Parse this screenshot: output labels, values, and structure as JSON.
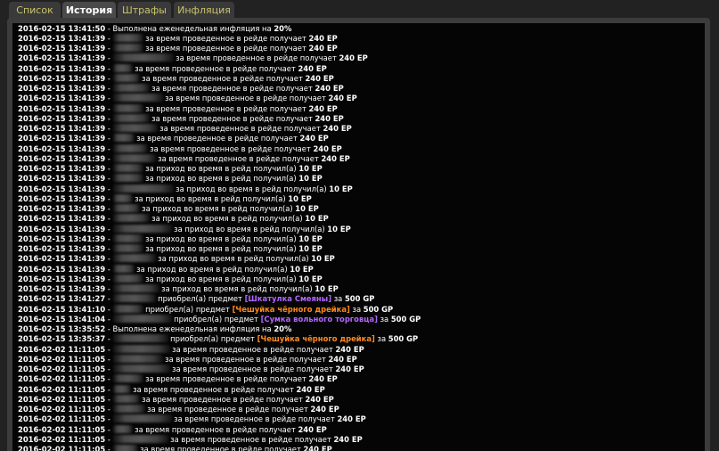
{
  "tabs": [
    {
      "label": "Список",
      "active": false
    },
    {
      "label": "История",
      "active": true
    },
    {
      "label": "Штрафы",
      "active": false
    },
    {
      "label": "Инфляция",
      "active": false
    }
  ],
  "log": [
    {
      "ts": "2016-02-15 13:41:50",
      "text": "- Выполнена еженедельная инфляция на",
      "amount": "20%",
      "blur": 0,
      "kind": "inflation"
    },
    {
      "ts": "2016-02-15 13:41:39",
      "text": "за время проведенное в рейде получает",
      "amount": "240 EP",
      "blur": 34
    },
    {
      "ts": "2016-02-15 13:41:39",
      "text": "за время проведенное в рейде получает",
      "amount": "240 EP",
      "blur": 34
    },
    {
      "ts": "2016-02-15 13:41:39",
      "text": "за время проведенное в рейде получает",
      "amount": "240 EP",
      "blur": 68
    },
    {
      "ts": "2016-02-15 13:41:39",
      "text": "за время проведенное в рейде получает",
      "amount": "240 EP",
      "blur": 22
    },
    {
      "ts": "2016-02-15 13:41:39",
      "text": "за время проведенное в рейде получает",
      "amount": "240 EP",
      "blur": 30
    },
    {
      "ts": "2016-02-15 13:41:39",
      "text": "за время проведенное в рейде получает",
      "amount": "240 EP",
      "blur": 41
    },
    {
      "ts": "2016-02-15 13:41:39",
      "text": "за время проведенное в рейде получает",
      "amount": "240 EP",
      "blur": 56
    },
    {
      "ts": "2016-02-15 13:41:39",
      "text": "за время проведенное в рейде получает",
      "amount": "240 EP",
      "blur": 34
    },
    {
      "ts": "2016-02-15 13:41:39",
      "text": "за время проведенное в рейде получает",
      "amount": "240 EP",
      "blur": 41
    },
    {
      "ts": "2016-02-15 13:41:39",
      "text": "за время проведенное в рейде получает",
      "amount": "240 EP",
      "blur": 50
    },
    {
      "ts": "2016-02-15 13:41:39",
      "text": "за время проведенное в рейде получает",
      "amount": "240 EP",
      "blur": 24
    },
    {
      "ts": "2016-02-15 13:41:39",
      "text": "за время проведенное в рейде получает",
      "amount": "240 EP",
      "blur": 39
    },
    {
      "ts": "2016-02-15 13:41:39",
      "text": "за время проведенное в рейде получает",
      "amount": "240 EP",
      "blur": 48
    },
    {
      "ts": "2016-02-15 13:41:39",
      "text": "за приход во время в рейд получил(а)",
      "amount": "10 EP",
      "blur": 34
    },
    {
      "ts": "2016-02-15 13:41:39",
      "text": "за приход во время в рейд получил(а)",
      "amount": "10 EP",
      "blur": 34
    },
    {
      "ts": "2016-02-15 13:41:39",
      "text": "за приход во время в рейд получил(а)",
      "amount": "10 EP",
      "blur": 68
    },
    {
      "ts": "2016-02-15 13:41:39",
      "text": "за приход во время в рейд получил(а)",
      "amount": "10 EP",
      "blur": 22
    },
    {
      "ts": "2016-02-15 13:41:39",
      "text": "за приход во время в рейд получил(а)",
      "amount": "10 EP",
      "blur": 30
    },
    {
      "ts": "2016-02-15 13:41:39",
      "text": "за приход во время в рейд получил(а)",
      "amount": "10 EP",
      "blur": 41
    },
    {
      "ts": "2016-02-15 13:41:39",
      "text": "за приход во время в рейд получил(а)",
      "amount": "10 EP",
      "blur": 66
    },
    {
      "ts": "2016-02-15 13:41:39",
      "text": "за приход во время в рейд получил(а)",
      "amount": "10 EP",
      "blur": 34
    },
    {
      "ts": "2016-02-15 13:41:39",
      "text": "за приход во время в рейд получил(а)",
      "amount": "10 EP",
      "blur": 34
    },
    {
      "ts": "2016-02-15 13:41:39",
      "text": "за приход во время в рейд получил(а)",
      "amount": "10 EP",
      "blur": 48
    },
    {
      "ts": "2016-02-15 13:41:39",
      "text": "за приход во время в рейд получил(а)",
      "amount": "10 EP",
      "blur": 24
    },
    {
      "ts": "2016-02-15 13:41:39",
      "text": "за приход во время в рейд получил(а)",
      "amount": "10 EP",
      "blur": 34
    },
    {
      "ts": "2016-02-15 13:41:39",
      "text": "за приход во время в рейд получил(а)",
      "amount": "10 EP",
      "blur": 52
    },
    {
      "ts": "2016-02-15 13:41:27",
      "text": "приобрел(а) предмет",
      "item": "[Шкатулка Смеяны]",
      "item_color": "purple",
      "suffix": "за",
      "amount": "500 GP",
      "blur": 48
    },
    {
      "ts": "2016-02-15 13:41:10",
      "text": "приобрел(а) предмет",
      "item": "[Чешуйка чёрного дрейка]",
      "item_color": "orange",
      "suffix": "за",
      "amount": "500 GP",
      "blur": 34
    },
    {
      "ts": "2016-02-15 13:41:04",
      "text": "приобрел(а) предмет",
      "item": "[Сумка вольного торговца]",
      "item_color": "purple",
      "suffix": "за",
      "amount": "500 GP",
      "blur": 66
    },
    {
      "ts": "2016-02-15 13:35:52",
      "text": "- Выполнена еженедельная инфляция на",
      "amount": "20%",
      "blur": 0,
      "kind": "inflation"
    },
    {
      "ts": "2016-02-15 13:35:37",
      "text": "приобрел(а) предмет",
      "item": "[Чешуйка чёрного дрейка]",
      "item_color": "orange",
      "suffix": "за",
      "amount": "500 GP",
      "blur": 62
    },
    {
      "ts": "2016-02-02 11:11:05",
      "text": "за время проведенное в рейде получает",
      "amount": "240 EP",
      "blur": 64
    },
    {
      "ts": "2016-02-02 11:11:05",
      "text": "за время проведенное в рейде получает",
      "amount": "240 EP",
      "blur": 56
    },
    {
      "ts": "2016-02-02 11:11:05",
      "text": "за время проведенное в рейде получает",
      "amount": "240 EP",
      "blur": 64
    },
    {
      "ts": "2016-02-02 11:11:05",
      "text": "за время проведенное в рейде получает",
      "amount": "240 EP",
      "blur": 34
    },
    {
      "ts": "2016-02-02 11:11:05",
      "text": "за время проведенное в рейде получает",
      "amount": "240 EP",
      "blur": 20
    },
    {
      "ts": "2016-02-02 11:11:05",
      "text": "за время проведенное в рейде получает",
      "amount": "240 EP",
      "blur": 30
    },
    {
      "ts": "2016-02-02 11:11:05",
      "text": "за время проведенное в рейде получает",
      "amount": "240 EP",
      "blur": 36
    },
    {
      "ts": "2016-02-02 11:11:05",
      "text": "за время проведенное в рейде получает",
      "amount": "240 EP",
      "blur": 66
    },
    {
      "ts": "2016-02-02 11:11:05",
      "text": "за время проведенное в рейде получает",
      "amount": "240 EP",
      "blur": 22
    },
    {
      "ts": "2016-02-02 11:11:05",
      "text": "за время проведенное в рейде получает",
      "amount": "240 EP",
      "blur": 62
    },
    {
      "ts": "2016-02-02 11:11:05",
      "text": "за время проведенное в рейде получает",
      "amount": "240 EP",
      "blur": 28
    }
  ]
}
